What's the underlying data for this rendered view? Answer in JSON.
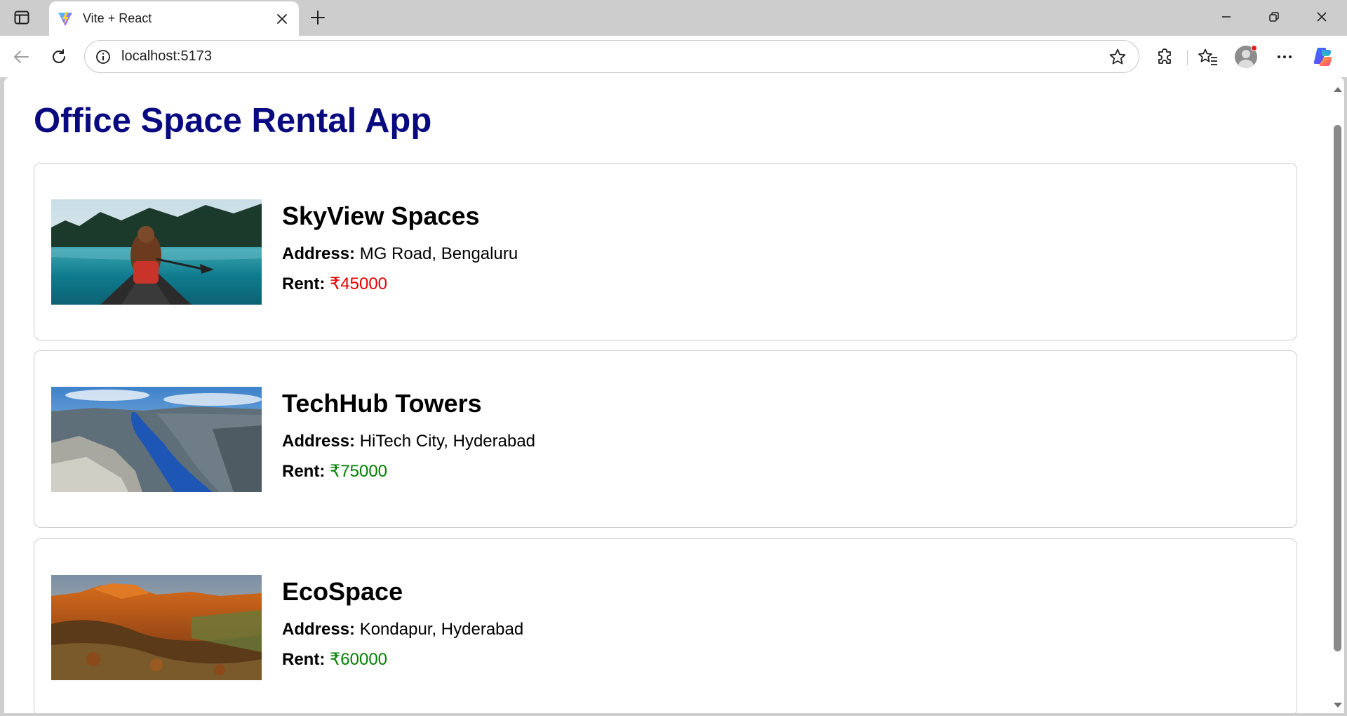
{
  "browser": {
    "tab_title": "Vite + React",
    "url": "localhost:5173",
    "icons": {
      "tab_actions": "tab-actions-icon",
      "favicon": "vite-logo-icon",
      "close": "close-icon",
      "new_tab": "plus-icon",
      "back": "back-arrow-icon",
      "reload": "reload-icon",
      "site_info": "info-icon",
      "favorite": "star-icon",
      "extensions": "puzzle-icon",
      "favorites": "favorites-icon",
      "profile": "profile-icon",
      "more": "more-icon",
      "copilot": "copilot-icon"
    }
  },
  "page": {
    "title": "Office Space Rental App",
    "address_label": "Address:",
    "rent_label": "Rent:",
    "offices": [
      {
        "name": "SkyView Spaces",
        "address": "MG Road, Bengaluru",
        "rent": "₹45000",
        "rent_color": "#e60000",
        "image": "lake-canoe-photo"
      },
      {
        "name": "TechHub Towers",
        "address": "HiTech City, Hyderabad",
        "rent": "₹75000",
        "rent_color": "#008000",
        "image": "fjord-cliff-photo"
      },
      {
        "name": "EcoSpace",
        "address": "Kondapur, Hyderabad",
        "rent": "₹60000",
        "rent_color": "#008000",
        "image": "canyon-sunset-photo"
      }
    ]
  },
  "colors": {
    "title": "#0a0a80",
    "rent_low": "#e60000",
    "rent_high": "#008000"
  }
}
